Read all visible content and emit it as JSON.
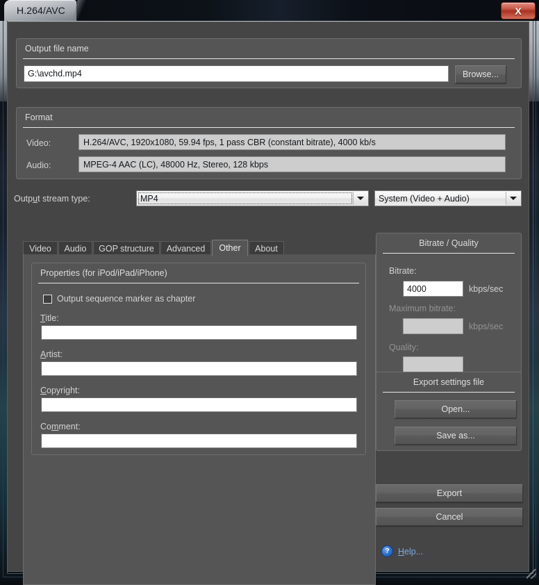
{
  "window": {
    "title": "H.264/AVC",
    "close_label": "X",
    "close_icon": "close-icon"
  },
  "output_file": {
    "group_title": "Output file name",
    "value": "G:\\avchd.mp4",
    "placeholder": "",
    "browse_label": "Browse..."
  },
  "format": {
    "group_title": "Format",
    "video_label": "Video:",
    "video_value": "H.264/AVC, 1920x1080, 59.94 fps, 1 pass CBR (constant bitrate), 4000 kb/s",
    "audio_label": "Audio:",
    "audio_value": "MPEG-4 AAC (LC), 48000 Hz, Stereo, 128 kbps"
  },
  "stream_type": {
    "label_pre": "Outp",
    "label_acc": "u",
    "label_post": "t stream type:",
    "container_value": "MP4",
    "container_options": [
      "MP4"
    ],
    "mux_value": "System (Video + Audio)",
    "mux_options": [
      "System (Video + Audio)"
    ]
  },
  "tabs": [
    {
      "label": "Video",
      "selected": false
    },
    {
      "label": "Audio",
      "selected": false
    },
    {
      "label": "GOP structure",
      "selected": false
    },
    {
      "label": "Advanced",
      "selected": false
    },
    {
      "label": "Other",
      "selected": true
    },
    {
      "label": "About",
      "selected": false
    }
  ],
  "properties": {
    "group_title": "Properties (for iPod/iPad/iPhone)",
    "checkbox_label": "Output sequence marker as chapter",
    "checkbox_checked": false,
    "fields": [
      {
        "acc": "T",
        "rest": "itle:",
        "value": ""
      },
      {
        "acc": "A",
        "rest": "rtist:",
        "value": ""
      },
      {
        "acc": "C",
        "rest": "opyright:",
        "value": ""
      },
      {
        "pre": "Co",
        "acc": "m",
        "rest": "ment:",
        "value": ""
      }
    ]
  },
  "bitrate_panel": {
    "group_title": "Bitrate / Quality",
    "bitrate_label": "Bitrate:",
    "bitrate_value": "4000",
    "bitrate_unit": "kbps/sec",
    "max_bitrate_label": "Maximum bitrate:",
    "max_bitrate_value": "",
    "max_bitrate_unit": "kbps/sec",
    "quality_label": "Quality:",
    "quality_value": ""
  },
  "export_settings": {
    "group_title": "Export settings file",
    "open_label": "Open...",
    "save_as_label": "Save as..."
  },
  "actions": {
    "export_label": "Export",
    "cancel_label": "Cancel",
    "help_label": "Help...",
    "help_acc": "H",
    "help_rest": "elp...",
    "help_icon": "question-mark-icon"
  },
  "colors": {
    "dialog_bg": "#454545",
    "group_bg": "#555555",
    "accent_blue": "#7fa9e0",
    "close_red": "#a83322",
    "text": "#d2d2d2"
  }
}
